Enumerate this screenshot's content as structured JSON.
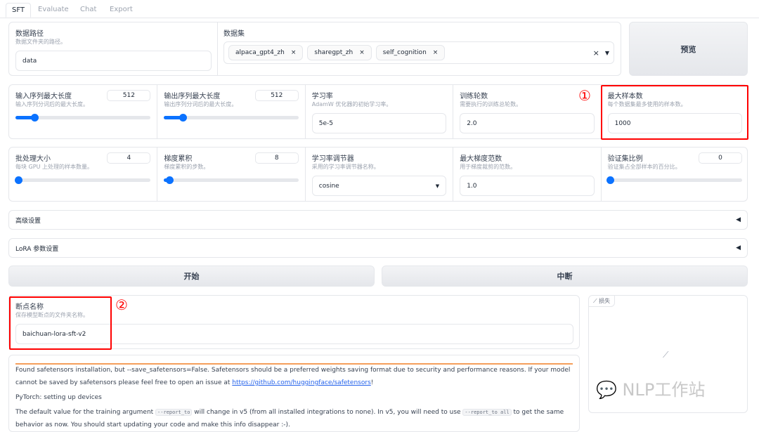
{
  "tabs": [
    "SFT",
    "Evaluate",
    "Chat",
    "Export"
  ],
  "data_path": {
    "label": "数据路径",
    "info": "数据文件夹的路径。",
    "value": "data"
  },
  "dataset": {
    "label": "数据集",
    "chips": [
      "alpaca_gpt4_zh",
      "sharegpt_zh",
      "self_cognition"
    ]
  },
  "preview_label": "预览",
  "row1": [
    {
      "label": "输入序列最大长度",
      "info": "输入序列分词后的最大长度。",
      "value": "512",
      "fraction": 0.14
    },
    {
      "label": "输出序列最大长度",
      "info": "输出序列分词后的最大长度。",
      "value": "512",
      "fraction": 0.14
    },
    {
      "label": "学习率",
      "info": "AdamW 优化器的初始学习率。",
      "value": "5e-5"
    },
    {
      "label": "训练轮数",
      "info": "需要执行的训练总轮数。",
      "value": "2.0"
    },
    {
      "label": "最大样本数",
      "info": "每个数据集最多使用的样本数。",
      "value": "1000"
    }
  ],
  "row2": [
    {
      "label": "批处理大小",
      "info": "每块 GPU 上处理的样本数量。",
      "value": "4",
      "fraction": 0.02
    },
    {
      "label": "梯度累积",
      "info": "梯度累积的步数。",
      "value": "8",
      "fraction": 0.04
    },
    {
      "label": "学习率调节器",
      "info": "采用的学习率调节器名称。",
      "value": "cosine"
    },
    {
      "label": "最大梯度范数",
      "info": "用于梯度裁剪的范数。",
      "value": "1.0"
    },
    {
      "label": "验证集比例",
      "info": "验证集占全部样本的百分比。",
      "value": "0",
      "fraction": 0
    }
  ],
  "advanced_label": "高级设置",
  "lora_label": "LoRA 参数设置",
  "start_label": "开始",
  "stop_label": "中断",
  "checkpoint": {
    "label": "断点名称",
    "info": "保存模型断点的文件夹名称。",
    "value": "baichuan-lora-sft-v2"
  },
  "loss_label": "损失",
  "annotations": [
    "①",
    "②"
  ],
  "watermark": "NLP工作站",
  "log": {
    "l1a": "Found safetensors installation, but --save_safetensors=False. Safetensors should be a preferred weights saving format due to security and performance reasons. If your model cannot be saved by safetensors please feel free to open an issue at ",
    "link": "https://github.com/huggingface/safetensors",
    "l1b": "!",
    "l2": "PyTorch: setting up devices",
    "l3a": "The default value for the training argument ",
    "code1": "--report_to",
    "l3b": " will change in v5 (from all installed integrations to none). In v5, you will need to use ",
    "code2": "--report_to all",
    "l3c": " to get the same behavior as now. You should start updating your code and make this info disappear :-)."
  },
  "colors": {
    "accent": "#0b72ff",
    "annotation": "#ff0000",
    "progress": "#f59e5b"
  }
}
